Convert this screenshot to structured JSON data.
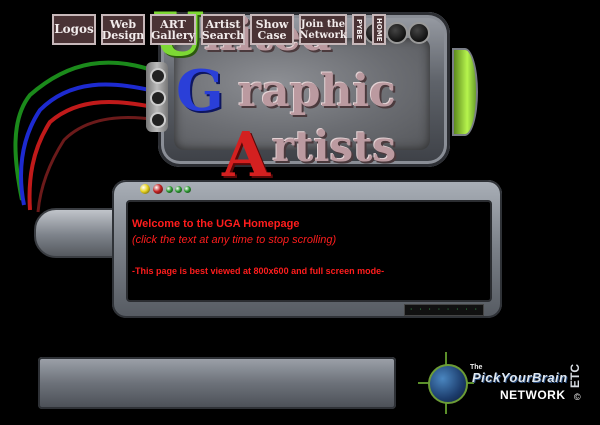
{
  "header": {
    "logo": {
      "letter_u": "U",
      "word_u": "nited",
      "letter_g": "G",
      "word_g": "raphic",
      "letter_a": "A",
      "word_a": "rtists",
      "colors": {
        "u": "#7dd834",
        "g": "#2a3fd8",
        "a": "#d42020"
      }
    }
  },
  "console": {
    "leds": [
      "#e8d31e",
      "#c22121",
      "#2f9a33",
      "#2f9a33",
      "#2f9a33"
    ],
    "welcome_title": "Welcome to the UGA Homepage",
    "scroll_hint": "(click the text at any time to stop scrolling)",
    "best_viewed": "-This page is best viewed at 800x600 and full screen mode-",
    "tiny_label": "· · · · · · · ·"
  },
  "nav": {
    "logos": "Logos",
    "web_design": "Web\nDesign",
    "art_gallery": "ART\nGallery",
    "artist_search": "Artist\nSearch",
    "show_case": "Show\nCase",
    "join_network": "Join the\nNetwork",
    "pybe": "PYBE",
    "home": "HOME"
  },
  "network": {
    "the": "The",
    "brand": "PickYourBrain",
    "network": "NETWORK",
    "copyright": "©",
    "etc": "ETC"
  }
}
